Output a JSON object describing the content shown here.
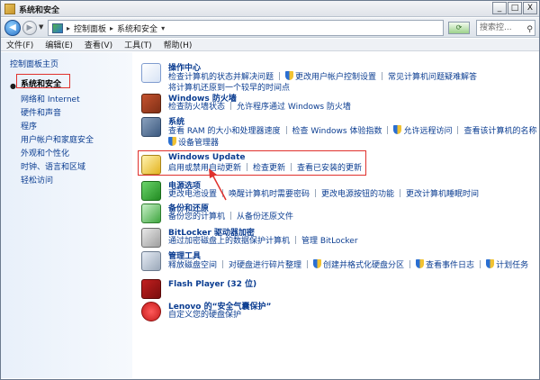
{
  "window": {
    "title": "系统和安全"
  },
  "title_buttons": {
    "minimize": "_",
    "maximize": "□",
    "close": "X"
  },
  "address": {
    "crumbs": [
      "控制面板",
      "系统和安全"
    ],
    "search_placeholder": "搜索控...",
    "back": "◀",
    "forward": "▶",
    "refresh": "⟳"
  },
  "menu": [
    "文件(F)",
    "编辑(E)",
    "查看(V)",
    "工具(T)",
    "帮助(H)"
  ],
  "sidebar": {
    "items": [
      {
        "label": "控制面板主页"
      },
      {
        "label": "系统和安全"
      },
      {
        "label": "网络和 Internet"
      },
      {
        "label": "硬件和声音"
      },
      {
        "label": "程序"
      },
      {
        "label": "用户帐户和家庭安全"
      },
      {
        "label": "外观和个性化"
      },
      {
        "label": "时钟、语言和区域"
      },
      {
        "label": "轻松访问"
      }
    ]
  },
  "categories": [
    {
      "title": "操作中心",
      "icon": "flag-icon",
      "lines": [
        [
          "检查计算机的状态并解决问题",
          "§更改用户帐户控制设置",
          "常见计算机问题疑难解答"
        ],
        [
          "将计算机还原到一个较早的时间点"
        ]
      ]
    },
    {
      "title": "Windows 防火墙",
      "icon": "firewall-icon",
      "lines": [
        [
          "检查防火墙状态",
          "允许程序通过 Windows 防火墙"
        ]
      ]
    },
    {
      "title": "系统",
      "icon": "system-icon",
      "lines": [
        [
          "查看 RAM 的大小和处理器速度",
          "检查 Windows 体验指数",
          "§允许远程访问",
          "查看该计算机的名称"
        ],
        [
          "§设备管理器"
        ]
      ]
    },
    {
      "title": "Windows Update",
      "icon": "windows-update-icon",
      "lines": [
        [
          "启用或禁用自动更新",
          "检查更新",
          "查看已安装的更新"
        ]
      ]
    },
    {
      "title": "电源选项",
      "icon": "power-icon",
      "lines": [
        [
          "更改电池设置",
          "唤醒计算机时需要密码",
          "更改电源按钮的功能",
          "更改计算机睡眠时间"
        ]
      ]
    },
    {
      "title": "备份和还原",
      "icon": "backup-icon",
      "lines": [
        [
          "备份您的计算机",
          "从备份还原文件"
        ]
      ]
    },
    {
      "title": "BitLocker 驱动器加密",
      "icon": "bitlocker-icon",
      "lines": [
        [
          "通过加密磁盘上的数据保护计算机",
          "管理 BitLocker"
        ]
      ]
    },
    {
      "title": "管理工具",
      "icon": "admin-tools-icon",
      "lines": [
        [
          "释放磁盘空间",
          "对硬盘进行碎片整理",
          "§创建并格式化硬盘分区",
          "§查看事件日志",
          "§计划任务"
        ]
      ]
    },
    {
      "title": "Flash Player (32 位)",
      "icon": "flash-icon",
      "lines": []
    },
    {
      "title": "Lenovo 的“安全气囊保护”",
      "icon": "lenovo-airbag-icon",
      "lines": [
        [
          "自定义您的硬盘保护"
        ]
      ]
    }
  ],
  "colors": {
    "link": "#0b3d91",
    "highlight": "#e0312d"
  }
}
